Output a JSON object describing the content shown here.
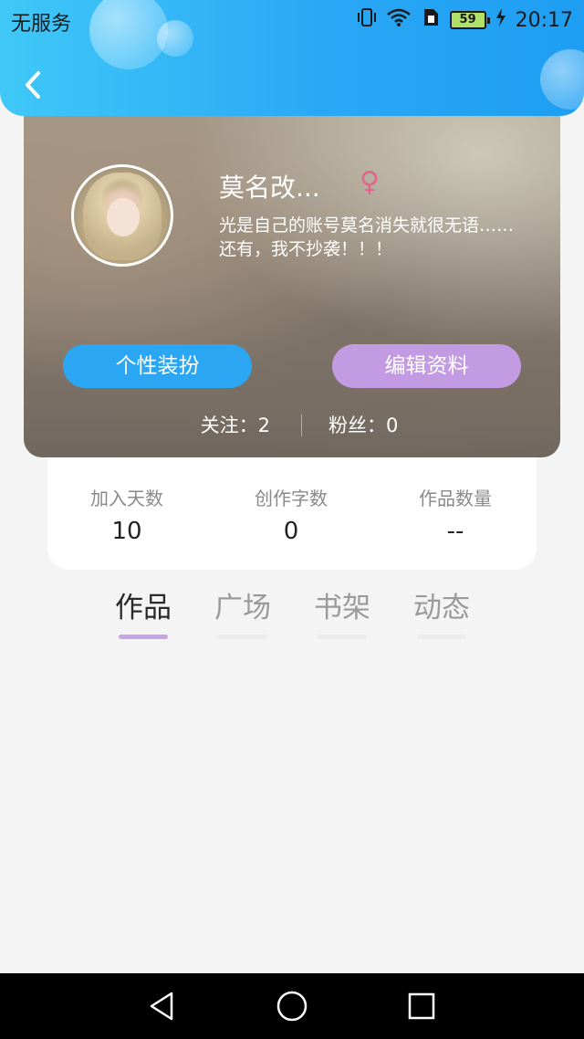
{
  "status_bar": {
    "carrier": "无服务",
    "battery": "59",
    "time": "20:17"
  },
  "profile": {
    "nickname": "莫名改...",
    "gender_symbol": "♀",
    "bio": "光是自己的账号莫名消失就很无语……还有，我不抄袭！！！",
    "dress_button": "个性装扮",
    "edit_button": "编辑资料",
    "following": "关注：2",
    "followers": "粉丝：0"
  },
  "stats": [
    {
      "label": "加入天数",
      "value": "10"
    },
    {
      "label": "创作字数",
      "value": "0"
    },
    {
      "label": "作品数量",
      "value": "--"
    }
  ],
  "tabs": [
    {
      "label": "作品"
    },
    {
      "label": "广场"
    },
    {
      "label": "书架"
    },
    {
      "label": "动态"
    }
  ],
  "colors": {
    "header_blue": "#2aa8f6",
    "dress_button": "#2ba6f3",
    "edit_button": "#c39be2",
    "active_tab_underline": "#c6a5e6",
    "gender_pink": "#e2668b"
  },
  "icons": {
    "back": "chevron-left-icon",
    "nav_back": "triangle-back-icon",
    "nav_home": "circle-home-icon",
    "nav_recent": "square-recent-icon"
  }
}
